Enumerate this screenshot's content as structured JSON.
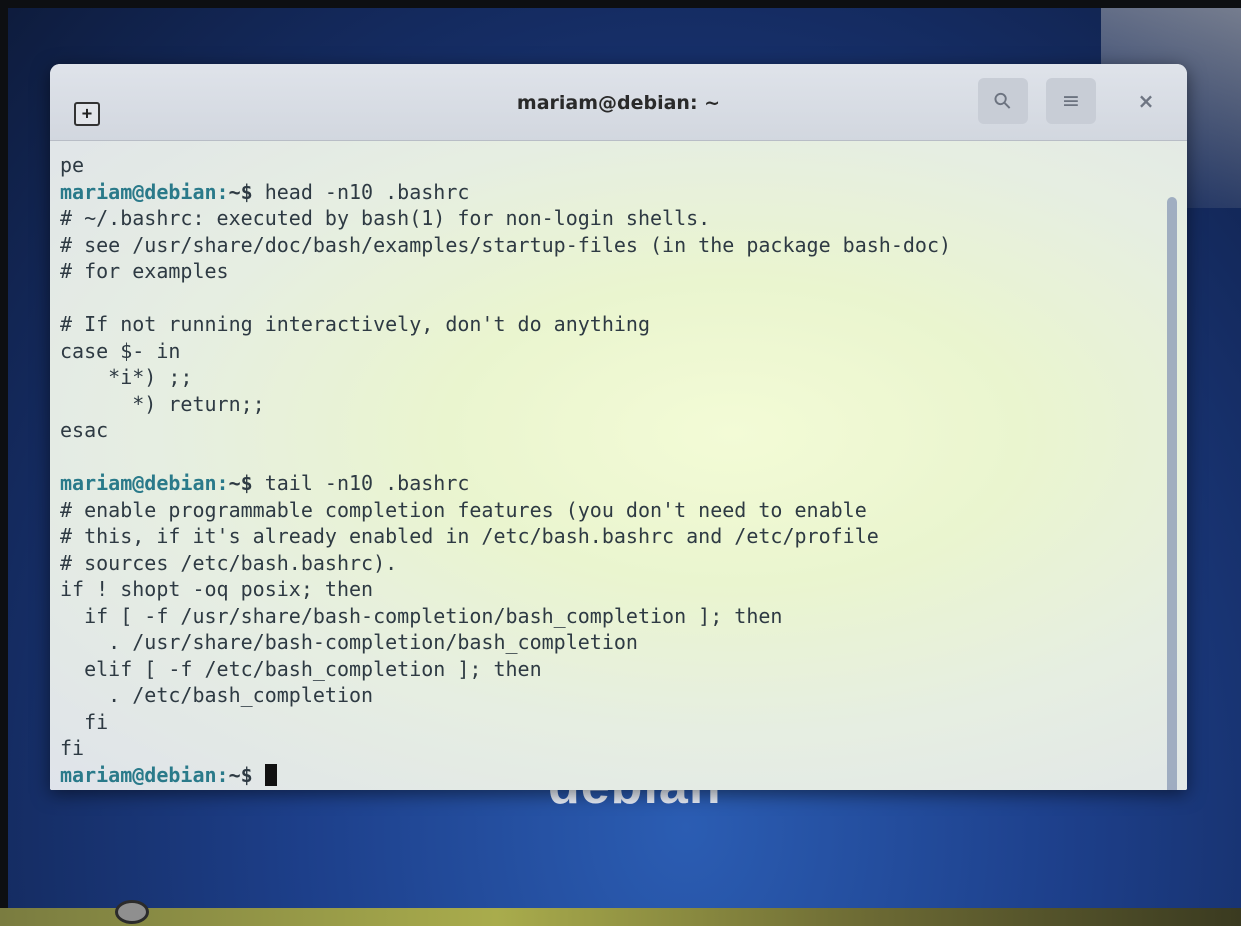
{
  "window": {
    "title": "mariam@debian: ~",
    "new_tab_symbol": "+",
    "search_symbol": "⚲",
    "menu_symbol": "≡",
    "close_symbol": "×"
  },
  "wallpaper": {
    "text": "debian"
  },
  "terminal": {
    "lines": [
      {
        "text": "pe"
      },
      {
        "prompt": "mariam@debian:",
        "path": "~$",
        "text": " head -n10 .bashrc"
      },
      {
        "text": "# ~/.bashrc: executed by bash(1) for non-login shells."
      },
      {
        "text": "# see /usr/share/doc/bash/examples/startup-files (in the package bash-doc)"
      },
      {
        "text": "# for examples"
      },
      {
        "text": ""
      },
      {
        "text": "# If not running interactively, don't do anything"
      },
      {
        "text": "case $- in"
      },
      {
        "text": "    *i*) ;;"
      },
      {
        "text": "      *) return;;"
      },
      {
        "text": "esac"
      },
      {
        "text": ""
      },
      {
        "prompt": "mariam@debian:",
        "path": "~$",
        "text": " tail -n10 .bashrc"
      },
      {
        "text": "# enable programmable completion features (you don't need to enable"
      },
      {
        "text": "# this, if it's already enabled in /etc/bash.bashrc and /etc/profile"
      },
      {
        "text": "# sources /etc/bash.bashrc)."
      },
      {
        "text": "if ! shopt -oq posix; then"
      },
      {
        "text": "  if [ -f /usr/share/bash-completion/bash_completion ]; then"
      },
      {
        "text": "    . /usr/share/bash-completion/bash_completion"
      },
      {
        "text": "  elif [ -f /etc/bash_completion ]; then"
      },
      {
        "text": "    . /etc/bash_completion"
      },
      {
        "text": "  fi"
      },
      {
        "text": "fi"
      },
      {
        "prompt": "mariam@debian:",
        "path": "~$",
        "text": " ",
        "cursor": true
      }
    ]
  },
  "colors": {
    "prompt": "#2a7a8a",
    "text": "#2e3a43",
    "header": "#d6dbe3"
  }
}
